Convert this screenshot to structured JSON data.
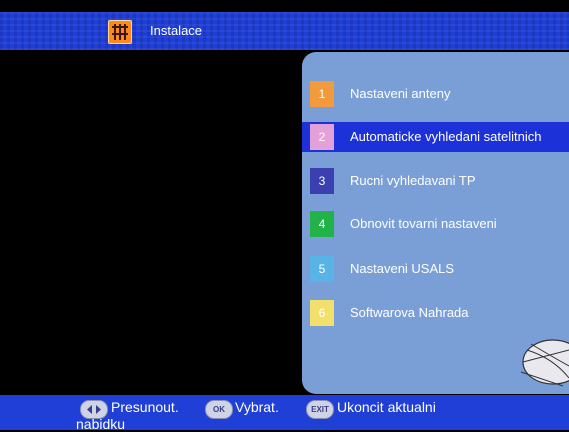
{
  "header": {
    "title": "Instalace",
    "icon": "installation-icon"
  },
  "menu": {
    "items": [
      {
        "number": "1",
        "label": "Nastaveni anteny",
        "color": "#f39a3c"
      },
      {
        "number": "2",
        "label": "Automaticke vyhledani satelitnich",
        "color": "#e4a0d8"
      },
      {
        "number": "3",
        "label": "Rucni vyhledavani TP",
        "color": "#3b3fb0"
      },
      {
        "number": "4",
        "label": "Obnovit tovarni nastaveni",
        "color": "#22b24a"
      },
      {
        "number": "5",
        "label": "Nastaveni USALS",
        "color": "#58b4e6"
      },
      {
        "number": "6",
        "label": "Softwarova Nahrada",
        "color": "#f2df6c"
      }
    ],
    "selected_index": 1
  },
  "footer": {
    "move_icon": "arrow-keys-icon",
    "move_label": "Presunout.",
    "ok_icon_text": "OK",
    "ok_label": "Vybrat.",
    "exit_icon_text": "EXIT",
    "exit_label": "Ukoncit aktualni",
    "exit_label_wrap": "nabidku"
  },
  "colors": {
    "header_bg": "#1f3fd6",
    "panel_bg": "#7a9fd6",
    "selected_bg": "#1c32d8"
  }
}
